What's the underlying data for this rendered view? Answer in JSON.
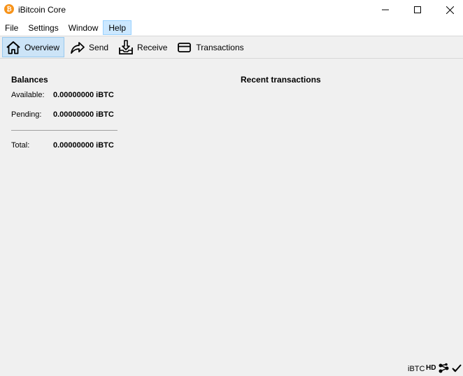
{
  "window": {
    "title": "iBitcoin Core",
    "icon_glyph": "₿",
    "brand_color": "#f7931a"
  },
  "menu": {
    "items": [
      {
        "label": "File"
      },
      {
        "label": "Settings"
      },
      {
        "label": "Window"
      },
      {
        "label": "Help"
      }
    ]
  },
  "toolbar": {
    "overview": "Overview",
    "send": "Send",
    "receive": "Receive",
    "transactions": "Transactions"
  },
  "balances": {
    "title": "Balances",
    "available_label": "Available:",
    "available_value": "0.00000000 iBTC",
    "pending_label": "Pending:",
    "pending_value": "0.00000000 iBTC",
    "total_label": "Total:",
    "total_value": "0.00000000 iBTC"
  },
  "recent": {
    "title": "Recent transactions"
  },
  "status": {
    "unit": "iBTC",
    "hd": "HD"
  }
}
